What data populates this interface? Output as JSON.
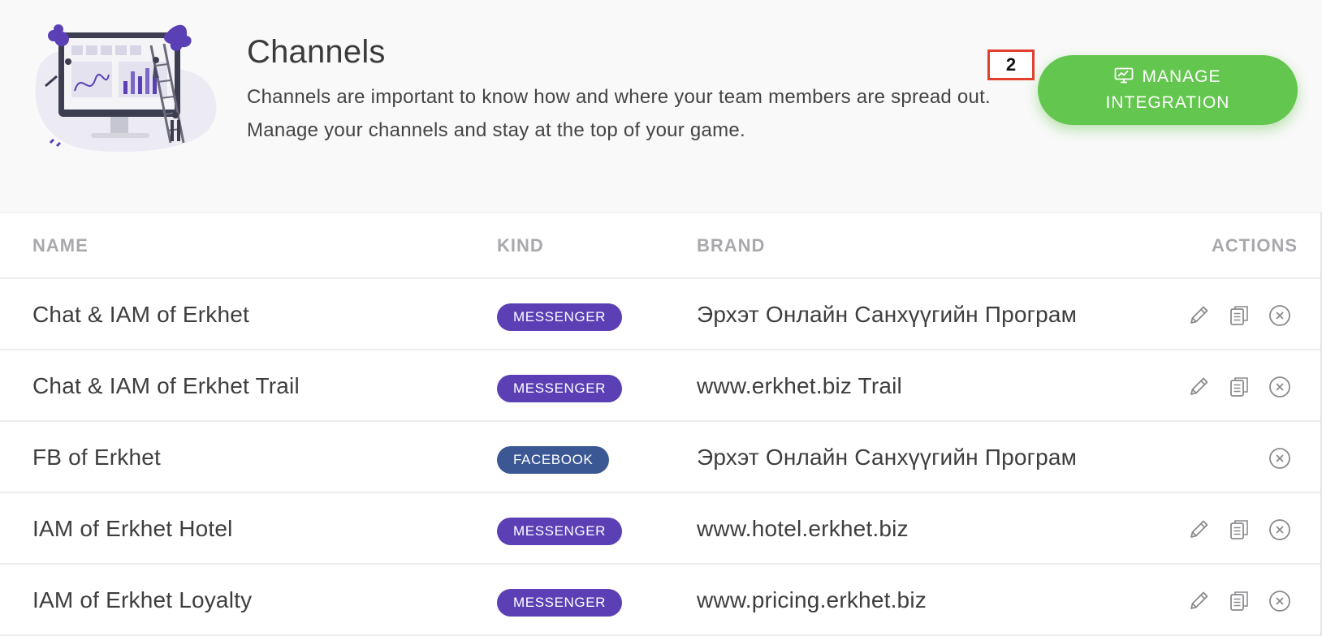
{
  "header": {
    "title": "Channels",
    "description": "Channels are important to know how and where your team members are spread out. Manage your channels and stay at the top of your game.",
    "marker_label": "2",
    "manage_button_label": "MANAGE INTEGRATION",
    "manage_button_icon": "monitor-chart-icon",
    "button_color": "#63c64e"
  },
  "table": {
    "columns": {
      "name": "NAME",
      "kind": "KIND",
      "brand": "BRAND",
      "actions": "ACTIONS"
    },
    "rows": [
      {
        "name": "Chat & IAM of Erkhet",
        "kind": "MESSENGER",
        "brand": "Эрхэт Онлайн Санхүүгийн Програм",
        "actions": [
          "edit",
          "copy",
          "remove"
        ]
      },
      {
        "name": "Chat & IAM of Erkhet Trail",
        "kind": "MESSENGER",
        "brand": "www.erkhet.biz Trail",
        "actions": [
          "edit",
          "copy",
          "remove"
        ]
      },
      {
        "name": "FB of Erkhet",
        "kind": "FACEBOOK",
        "brand": "Эрхэт Онлайн Санхүүгийн Програм",
        "actions": [
          "remove"
        ]
      },
      {
        "name": "IAM of Erkhet Hotel",
        "kind": "MESSENGER",
        "brand": "www.hotel.erkhet.biz",
        "actions": [
          "edit",
          "copy",
          "remove"
        ]
      },
      {
        "name": "IAM of Erkhet Loyalty",
        "kind": "MESSENGER",
        "brand": "www.pricing.erkhet.biz",
        "actions": [
          "edit",
          "copy",
          "remove"
        ]
      }
    ]
  },
  "kind_colors": {
    "MESSENGER": "#5b3fb5",
    "FACEBOOK": "#3b5895"
  },
  "icons": {
    "edit": "pencil-icon",
    "copy": "copy-icon",
    "remove": "close-circle-icon"
  }
}
